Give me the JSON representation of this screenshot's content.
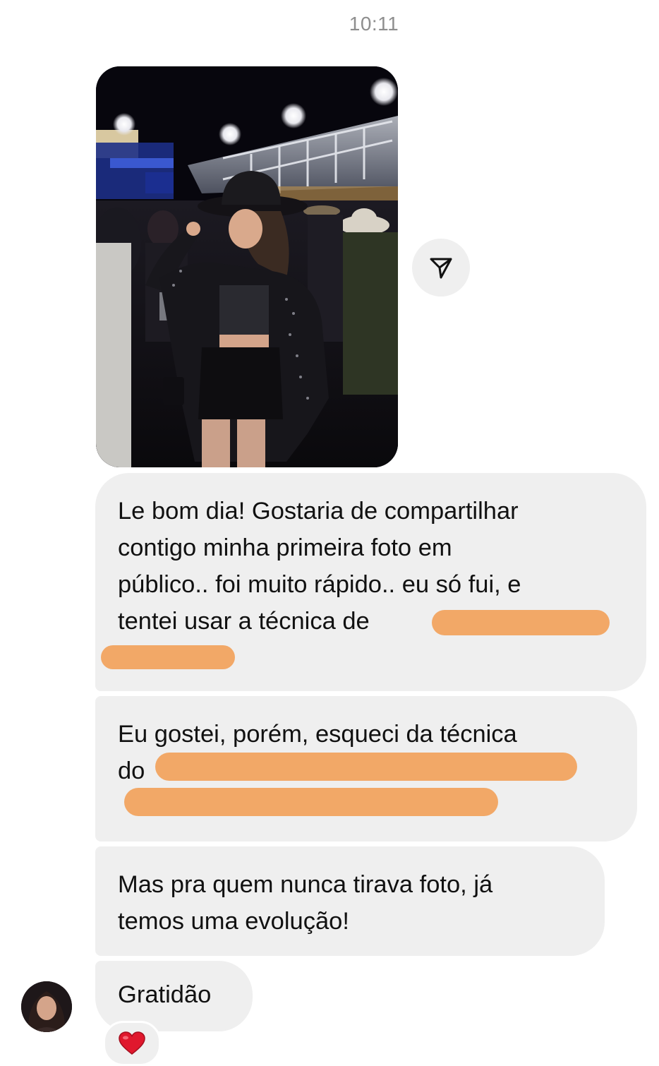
{
  "header": {
    "time": "10:11"
  },
  "media": {
    "share_icon": "paper-plane-icon"
  },
  "messages": [
    {
      "lines": [
        "Le bom dia! Gostaria de compartilhar",
        "contigo minha primeira foto em",
        "público.. foi muito rápido.. eu só fui, e",
        "tentei usar a técnica de"
      ]
    },
    {
      "lines": [
        "Eu gostei, porém, esqueci da técnica",
        "do"
      ]
    },
    {
      "lines": [
        "Mas pra quem nunca tirava foto, já",
        "temos uma evolução!"
      ]
    },
    {
      "lines": [
        "Gratidão"
      ]
    }
  ],
  "reaction": {
    "icon": "heart-icon",
    "emoji": "❤️"
  },
  "colors": {
    "bubble": "#efefef",
    "redaction": "#f2a867",
    "timestamp": "#8e8e8e"
  }
}
